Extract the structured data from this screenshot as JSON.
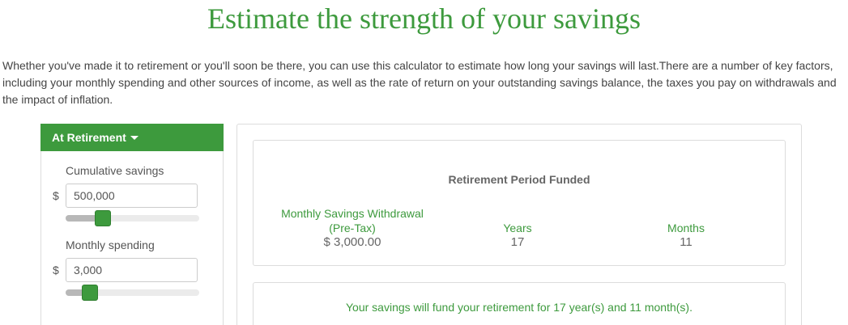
{
  "page": {
    "title": "Estimate the strength of your savings",
    "intro": "Whether you've made it to retirement or you'll soon be there, you can use this calculator to estimate how long your savings will last.There are a number of key factors, including your monthly spending and other sources of income, as well as the rate of return on your outstanding savings balance, the taxes you pay on withdrawals and the impact of inflation."
  },
  "left_panel": {
    "header": "At Retirement",
    "savings": {
      "label": "Cumulative savings",
      "currency": "$",
      "value": "500,000",
      "slider_fraction": 0.25
    },
    "spending": {
      "label": "Monthly spending",
      "currency": "$",
      "value": "3,000",
      "slider_fraction": 0.14
    }
  },
  "results": {
    "title": "Retirement Period Funded",
    "withdrawal_head_line1": "Monthly Savings Withdrawal",
    "withdrawal_head_line2": "(Pre-Tax)",
    "withdrawal_value": "$ 3,000.00",
    "years_head": "Years",
    "years_value": "17",
    "months_head": "Months",
    "months_value": "11"
  },
  "summary": {
    "text": "Your savings will fund your retirement for 17 year(s) and 11 month(s)."
  },
  "colors": {
    "accent": "#3d9a3d",
    "border": "#dcdcdc"
  }
}
